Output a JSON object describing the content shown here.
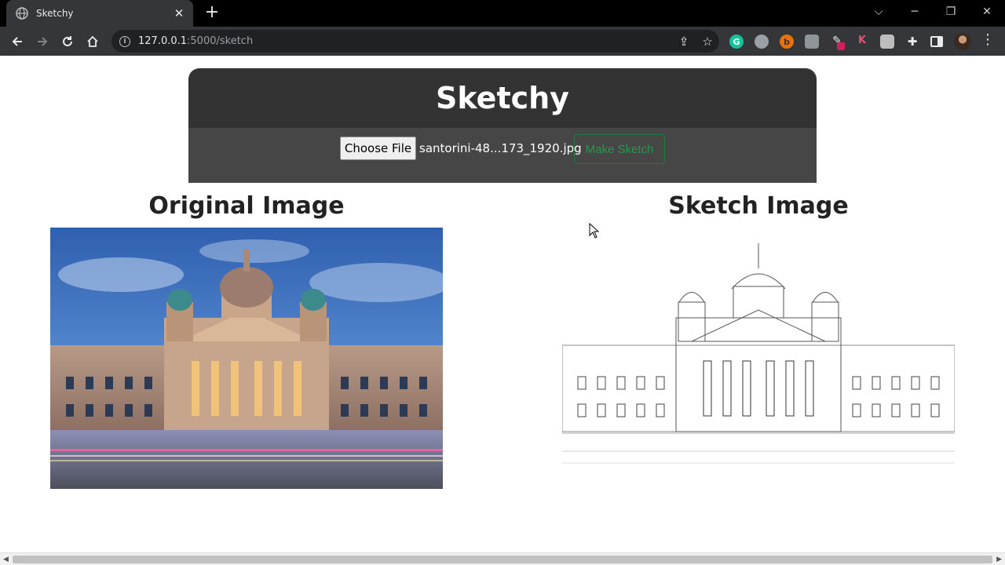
{
  "browser": {
    "tab_title": "Sketchy",
    "tab_close": "✕",
    "new_tab": "+",
    "url_host": "127.0.0.1",
    "url_rest": ":5000/sketch",
    "controls": {
      "dropdown": "⌵",
      "minimize": "─",
      "restore": "❐",
      "close": "✕"
    }
  },
  "extensions": [
    "grammarly-icon",
    "s-icon",
    "b-icon",
    "n-icon",
    "pen-icon",
    "k-icon",
    "w-icon",
    "puzzle-icon",
    "sidepanel-icon"
  ],
  "app": {
    "title": "Sketchy",
    "choose_file_label": "Choose File",
    "file_name": "santorini-48...173_1920.jpg",
    "make_sketch_label": "Make Sketch",
    "accent_color": "#27984d"
  },
  "panels": {
    "original_title": "Original Image",
    "sketch_title": "Sketch Image"
  }
}
